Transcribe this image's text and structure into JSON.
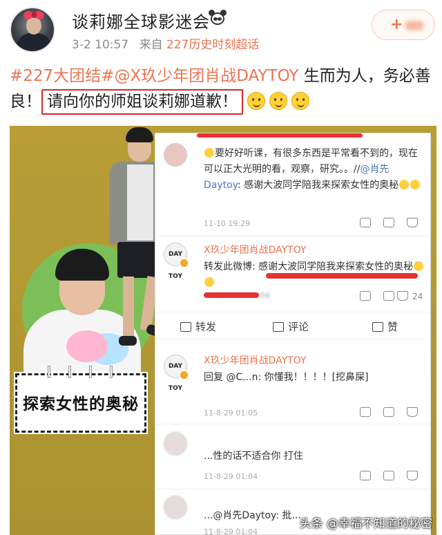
{
  "post": {
    "username": "谈莉娜全球影迷会",
    "time": "3-2 10:57",
    "source_prefix": "来自",
    "source": "227历史时刻超话",
    "follow_label": "+"
  },
  "text": {
    "tag": "#227大团结#",
    "mention": "@X玖少年团肖战DAYTOY",
    "plain1": " 生而为人，务必善良！",
    "boxed": "请向你的师姐谈莉娜道歉！"
  },
  "image": {
    "caption": "探索女性的奥秘",
    "watermark": "头条 @幸福不知道的秘密",
    "comments": [
      {
        "text_a": "要好好听课，有很多东西是平常看不到的，现在可以正大光明的看，观察，研究。。//",
        "text_at": "@肖先Daytoy",
        "text_b": ": 感谢大波同学陪我来探索女性的奥秘",
        "time": "11-10 19:29"
      },
      {
        "name": "X玖少年团肖战DAYTOY",
        "text": "转发此微博: 感谢大波同学陪我来探索女性的奥秘",
        "count_blur": "56",
        "likes": "24"
      },
      {
        "name": "X玖少年团肖战DAYTOY",
        "text": "回复 @C...n: 你懂我！！！！[挖鼻屎]",
        "time": "11-8-29 01:05"
      },
      {
        "text": "...性的话不适合你  打住",
        "time": "11-8-29 01:04"
      },
      {
        "text": "...@肖先Daytoy: 批...",
        "time": "11-8-29 01:04"
      }
    ],
    "actions": {
      "repost": "转发",
      "comment": "评论",
      "like": "赞"
    },
    "avatar_label": "DAY TOY"
  },
  "colors": {
    "accent": "#eb7350",
    "highlight_border": "#d62828",
    "olive_bg": "#b59c33"
  }
}
